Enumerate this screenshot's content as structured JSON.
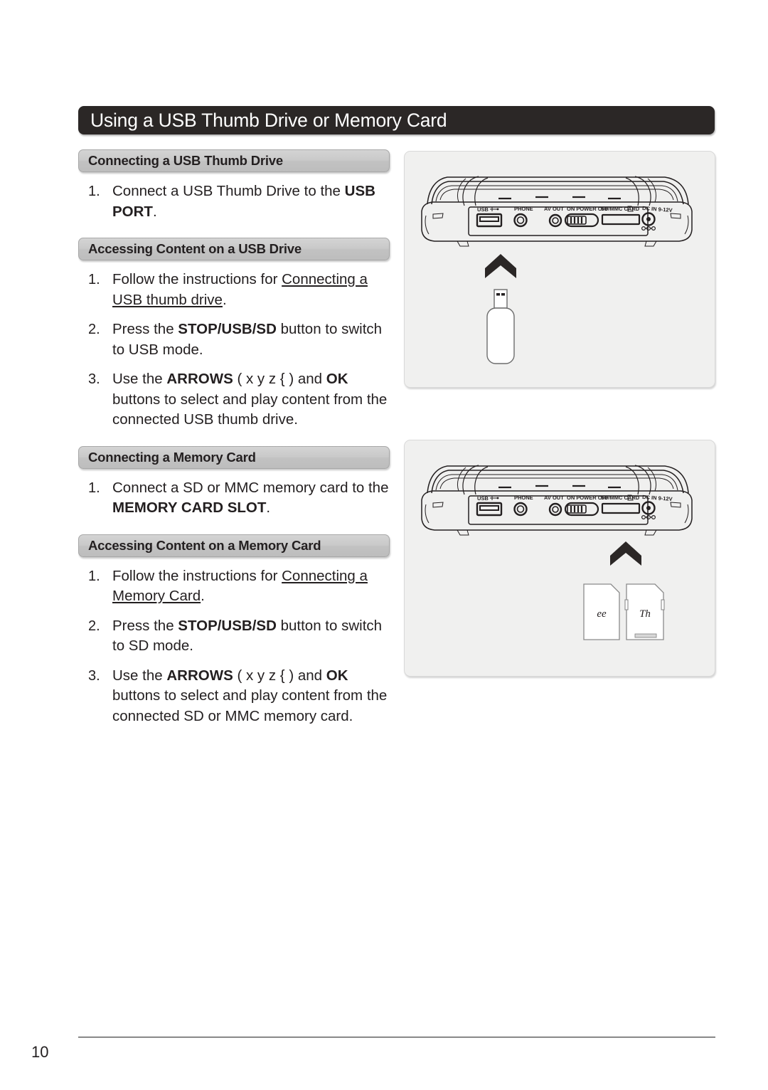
{
  "page": {
    "title": "Using a USB Thumb Drive or Memory Card",
    "number": "10"
  },
  "sections": [
    {
      "heading": "Connecting a USB Thumb Drive",
      "steps": [
        {
          "num": "1.",
          "parts": [
            {
              "text": "Connect a USB Thumb Drive to the ",
              "style": "normal"
            },
            {
              "text": "USB PORT",
              "style": "bold"
            },
            {
              "text": ".",
              "style": "normal"
            }
          ]
        }
      ]
    },
    {
      "heading": "Accessing Content on  a USB Drive",
      "steps": [
        {
          "num": "1.",
          "parts": [
            {
              "text": "Follow the instructions for ",
              "style": "normal"
            },
            {
              "text": "Connecting a USB thumb drive",
              "style": "underline"
            },
            {
              "text": ".",
              "style": "normal"
            }
          ]
        },
        {
          "num": "2.",
          "parts": [
            {
              "text": "Press the ",
              "style": "normal"
            },
            {
              "text": "STOP/USB/SD",
              "style": "bold"
            },
            {
              "text": " button to switch to USB mode.",
              "style": "normal"
            }
          ]
        },
        {
          "num": "3.",
          "parts": [
            {
              "text": "Use the ",
              "style": "normal"
            },
            {
              "text": "ARROWS",
              "style": "bold"
            },
            {
              "text": " ( x y z {    ) and ",
              "style": "normal"
            },
            {
              "text": "OK",
              "style": "bold"
            },
            {
              "text": " buttons to select and play content from the connected USB thumb drive.",
              "style": "normal"
            }
          ]
        }
      ]
    },
    {
      "heading": "Connecting a Memory Card",
      "steps": [
        {
          "num": "1.",
          "parts": [
            {
              "text": "Connect a SD or MMC memory card to the ",
              "style": "normal"
            },
            {
              "text": "MEMORY CARD SLOT",
              "style": "bold"
            },
            {
              "text": ".",
              "style": "normal"
            }
          ]
        }
      ]
    },
    {
      "heading": "Accessing Content on  a Memory Card",
      "steps": [
        {
          "num": "1.",
          "parts": [
            {
              "text": "Follow the instructions for ",
              "style": "normal"
            },
            {
              "text": "Connecting a Memory Card",
              "style": "underline"
            },
            {
              "text": ".",
              "style": "normal"
            }
          ]
        },
        {
          "num": "2.",
          "parts": [
            {
              "text": "Press the ",
              "style": "normal"
            },
            {
              "text": "STOP/USB/SD",
              "style": "bold"
            },
            {
              "text": " button to switch to SD mode.",
              "style": "normal"
            }
          ]
        },
        {
          "num": "3.",
          "parts": [
            {
              "text": "Use the ",
              "style": "normal"
            },
            {
              "text": "ARROWS",
              "style": "bold"
            },
            {
              "text": " ( x y z {    ) and ",
              "style": "normal"
            },
            {
              "text": "OK",
              "style": "bold"
            },
            {
              "text": " buttons to select and play content from the connected SD or MMC memory card.",
              "style": "normal"
            }
          ]
        }
      ]
    }
  ],
  "illustrations": {
    "usb_panel": {
      "device_port_labels": [
        "USB",
        "PHONE",
        "AV OUT",
        "ON POWER OFF",
        "SD/MMC CARD",
        "DC IN 9-12V"
      ],
      "callout": "usb-thumb-drive"
    },
    "card_panel": {
      "device_port_labels": [
        "USB",
        "PHONE",
        "AV OUT",
        "ON POWER OFF",
        "SD/MMC CARD",
        "DC IN 9-12V"
      ],
      "callout": "memory-cards",
      "card_labels": [
        "ee",
        "Th"
      ]
    }
  },
  "colors": {
    "title_bar": "#2b2726",
    "section_bar": "#c9c9c9",
    "panel_bg": "#f0f0ef",
    "text": "#231f20"
  }
}
